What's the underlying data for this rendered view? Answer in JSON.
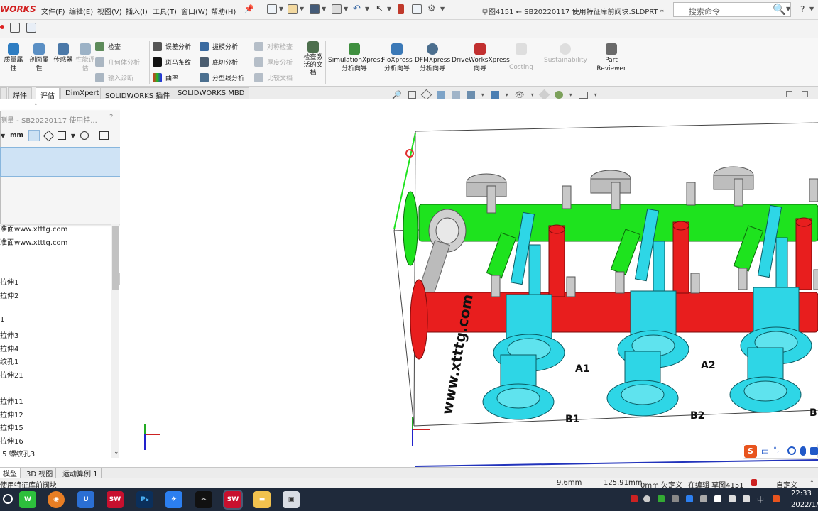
{
  "app": {
    "logo": "WORKS"
  },
  "menu": [
    "文件(F)",
    "编辑(E)",
    "视图(V)",
    "插入(I)",
    "工具(T)",
    "窗口(W)",
    "帮助(H)"
  ],
  "title": "草图4151 ← SB20220117 使用特征库前阀块.SLDPRT *",
  "search": {
    "placeholder": "搜索命令"
  },
  "ribbon": {
    "large": [
      {
        "label": "质量属性",
        "color": "#2e7dc2"
      },
      {
        "label": "剖面属性",
        "color": "#5a8fc4"
      },
      {
        "label": "传感器",
        "color": "#4a78a8"
      },
      {
        "label": "性能评估",
        "color": "#9cb2c6",
        "disabled": true
      }
    ],
    "col1": [
      {
        "label": "检查",
        "color": "#5d8b5a",
        "disabled": false
      },
      {
        "label": "几何体分析",
        "color": "#aab6c2",
        "disabled": true
      },
      {
        "label": "输入诊断",
        "color": "#aab6c2",
        "disabled": true
      }
    ],
    "col2": [
      {
        "label": "误差分析",
        "color": "#555555",
        "disabled": false
      },
      {
        "label": "斑马条纹",
        "color": "#111111",
        "disabled": false
      },
      {
        "label": "曲率",
        "color": "#9b3fbf",
        "disabled": false
      }
    ],
    "col3": [
      {
        "label": "拔模分析",
        "color": "#3a6aa0",
        "disabled": false
      },
      {
        "label": "底切分析",
        "color": "#4b5d70",
        "disabled": false
      },
      {
        "label": "分型线分析",
        "color": "#4b6f8f",
        "disabled": false
      }
    ],
    "col4": [
      {
        "label": "对称检查",
        "color": "#b5bec8",
        "disabled": true
      },
      {
        "label": "厚度分析",
        "color": "#b5bec8",
        "disabled": true
      },
      {
        "label": "比较文档",
        "color": "#b5bec8",
        "disabled": true
      }
    ],
    "check_active": "检查激活的文档",
    "addins": [
      {
        "line1": "SimulationXpress",
        "line2": "分析向导",
        "color": "#3f8f3f",
        "disabled": false
      },
      {
        "line1": "FloXpress",
        "line2": "分析向导",
        "color": "#3b79b7",
        "disabled": false
      },
      {
        "line1": "DFMXpress",
        "line2": "分析向导",
        "color": "#4b6e8e",
        "disabled": false
      },
      {
        "line1": "DriveWorksXpress",
        "line2": "向导",
        "color": "#c23030",
        "disabled": false
      },
      {
        "line1": "Costing",
        "line2": "",
        "color": "#bdbdbd",
        "disabled": true
      },
      {
        "line1": "Sustainability",
        "line2": "",
        "color": "#bdbdbd",
        "disabled": true
      },
      {
        "line1": "Part",
        "line2": "Reviewer",
        "color": "#6a6a6a",
        "disabled": false
      }
    ]
  },
  "tabs": [
    "焊件",
    "评估",
    "DimXpert",
    "SOLIDWORKS 插件",
    "SOLIDWORKS MBD"
  ],
  "active_tab": "评估",
  "measure": {
    "title": "测量 - SB20220117 使用特...",
    "help": "?",
    "close": "✕"
  },
  "tree": [
    "准面www.xtttg.com",
    "准面www.xtttg.com",
    "拉伸1",
    "拉伸2",
    "1",
    "拉伸3",
    "拉伸4",
    "纹孔1",
    "拉伸21",
    "拉伸11",
    "拉伸12",
    "拉伸15",
    "拉伸16",
    ".5 螺纹孔3"
  ],
  "bottom_tabs": [
    "模型",
    "3D 视图",
    "运动算例 1"
  ],
  "status": {
    "left": "使用特征库前阀块",
    "v1": "9.6mm",
    "v2": "125.91mm",
    "v3": "0mm 欠定义",
    "v4": "在编辑 草图4151",
    "v5": "自定义"
  },
  "viewport": {
    "watermark": "www.xtttg.com",
    "labels": [
      "A1",
      "A2",
      "B1",
      "B2",
      "B"
    ],
    "colors": {
      "green": "#1ee31e",
      "red": "#e81e1e",
      "cyan": "#2ed6e6",
      "gray": "#c8c8c8"
    }
  },
  "ime": {
    "label": "中"
  },
  "clock": {
    "time": "22:33",
    "date": "2022/1/"
  }
}
